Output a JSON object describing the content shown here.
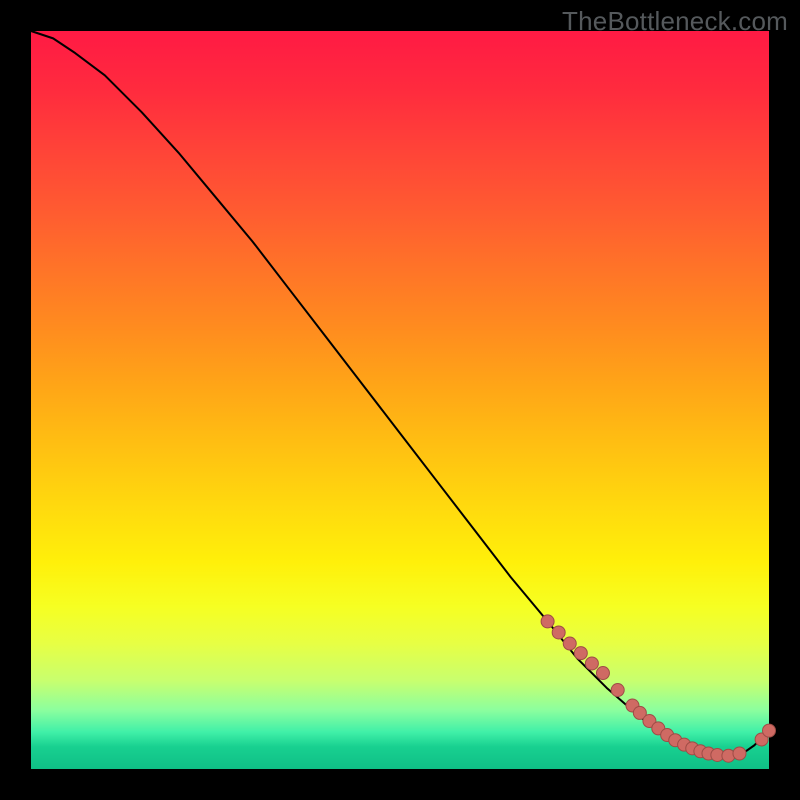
{
  "watermark": "TheBottleneck.com",
  "colors": {
    "curve_stroke": "#000000",
    "marker_fill": "#cf6a63",
    "marker_stroke": "#9e4c46"
  },
  "chart_data": {
    "type": "line",
    "title": "",
    "xlabel": "",
    "ylabel": "",
    "xlim": [
      0,
      100
    ],
    "ylim": [
      0,
      100
    ],
    "x": [
      0,
      3,
      6,
      10,
      15,
      20,
      25,
      30,
      35,
      40,
      45,
      50,
      55,
      60,
      65,
      70,
      74,
      78,
      82,
      85,
      88,
      90,
      92,
      94,
      96,
      98,
      100
    ],
    "values": [
      100,
      99,
      97,
      94,
      89,
      83.5,
      77.5,
      71.5,
      65,
      58.5,
      52,
      45.5,
      39,
      32.5,
      26,
      20,
      15,
      11,
      7.5,
      5,
      3.2,
      2.2,
      1.6,
      1.4,
      1.8,
      3.2,
      5.2
    ],
    "markers_x": [
      70,
      71.5,
      73,
      74.5,
      76,
      77.5,
      79.5,
      81.5,
      82.5,
      83.8,
      85,
      86.2,
      87.3,
      88.5,
      89.6,
      90.7,
      91.8,
      93,
      94.5,
      96,
      99,
      100
    ],
    "markers_y": [
      20,
      18.5,
      17,
      15.7,
      14.3,
      13,
      10.7,
      8.6,
      7.6,
      6.5,
      5.5,
      4.6,
      3.9,
      3.3,
      2.8,
      2.4,
      2.1,
      1.9,
      1.8,
      2.1,
      4.0,
      5.2
    ]
  }
}
